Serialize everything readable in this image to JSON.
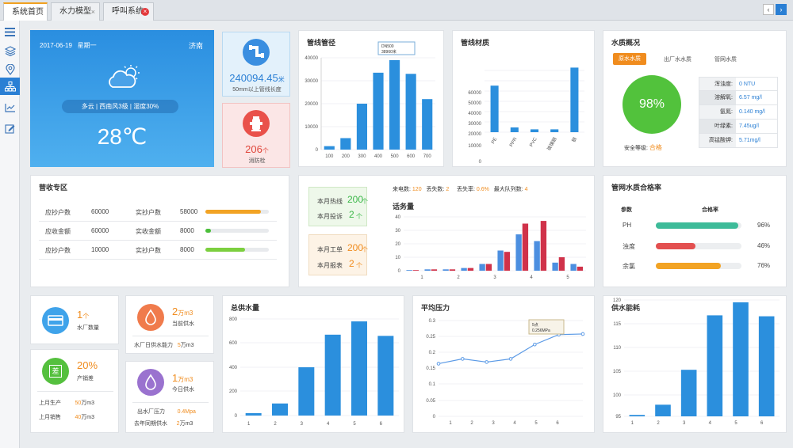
{
  "tabs": [
    {
      "label": "系统首页"
    },
    {
      "label": "水力模型"
    },
    {
      "label": "呼叫系统"
    }
  ],
  "sidebar": [
    "menu-icon",
    "layers-icon",
    "location-icon",
    "org-chart-icon",
    "chart-icon",
    "edit-icon"
  ],
  "weather": {
    "date": "2017-06-19",
    "weekday": "星期一",
    "city": "济南",
    "desc": "多云 | 西南风3级 | 湿度30%",
    "temp": "28℃"
  },
  "pipe_len": {
    "value": "240094.45",
    "unit": "米",
    "label": "50mm以上管线长度"
  },
  "hydrant": {
    "value": "206",
    "unit": "个",
    "label": "消防栓"
  },
  "diameter": {
    "title": "管线管径",
    "tooltip_l1": "DN500",
    "tooltip_l2": "38960米",
    "yticks": [
      "0",
      "10000",
      "20000",
      "30000",
      "40000"
    ]
  },
  "material": {
    "title": "管线材质",
    "yticks": [
      "0",
      "10000",
      "20000",
      "30000",
      "40000",
      "50000",
      "60000"
    ]
  },
  "quality": {
    "title": "水质概况",
    "tabs": [
      "原水水质",
      "出厂水水质",
      "管网水质"
    ],
    "score": "98%",
    "grade_label": "安全等级:",
    "grade": "合格",
    "rows": [
      {
        "k": "浑浊度:",
        "v": "0 NTU"
      },
      {
        "k": "溶解氧:",
        "v": "6.57 mg/l"
      },
      {
        "k": "氨氮:",
        "v": "0.140 mg/l"
      },
      {
        "k": "叶绿素:",
        "v": "7.45ug/l"
      },
      {
        "k": "高锰酸钾:",
        "v": "5.71mg/l"
      }
    ]
  },
  "revenue": {
    "title": "营收专区",
    "rows": [
      {
        "a": "应抄户数",
        "av": "60000",
        "b": "实抄户数",
        "bv": "58000",
        "color": "#f2a324",
        "pct": 0.87
      },
      {
        "a": "应收金额",
        "av": "60000",
        "b": "实收金额",
        "bv": "8000",
        "color": "#4bbf3a",
        "pct": 0.09
      },
      {
        "a": "应抄户数",
        "av": "10000",
        "b": "实抄户数",
        "bv": "8000",
        "color": "#7ccf3f",
        "pct": 0.63
      }
    ]
  },
  "calls": {
    "hotline_label": "本月热线",
    "hotline": "200",
    "hotline_unit": "个",
    "complaint_label": "本月投诉",
    "complaint": "2",
    "complaint_unit": "个",
    "order_label": "本月工单",
    "order": "200",
    "order_unit": "个",
    "report_label": "本月报表",
    "report": "2",
    "report_unit": "个",
    "incoming_label": "来电数:",
    "incoming": "120",
    "lost_label": "丢失数:",
    "lost": "2",
    "rate_label": "丢失率:",
    "rate": "0.6%",
    "queue_label": "最大队列数:",
    "queue": "4",
    "chart_title": "话务量",
    "yticks": [
      "0",
      "10",
      "20",
      "30",
      "40"
    ]
  },
  "pipe_quality": {
    "title": "管网水质合格率",
    "col1": "参数",
    "col2": "合格率",
    "rows": [
      {
        "name": "PH",
        "pct": "96%",
        "color": "#3dbb99"
      },
      {
        "name": "浊度",
        "pct": "46%",
        "color": "#e35050"
      },
      {
        "name": "余氯",
        "pct": "76%",
        "color": "#f2a324"
      }
    ]
  },
  "plants": {
    "count": "1",
    "unit": "个",
    "label": "水厂数量"
  },
  "supply": {
    "value": "2",
    "unit": "万m3",
    "label": "当前供水",
    "cap_label": "水厂日供水能力",
    "cap": "5",
    "cap_unit": "万m3"
  },
  "diff": {
    "value": "20%",
    "label": "产销差",
    "icon_char": "差",
    "prod_label": "上月生产",
    "prod": "50",
    "prod_unit": "万m3",
    "sale_label": "上月销售",
    "sale": "40",
    "sale_unit": "万m3"
  },
  "today": {
    "value": "1",
    "unit": "万m3",
    "label": "今日供水",
    "press_label": "出水厂压力",
    "press": "0.4Mpa",
    "last_label": "去年同期供水",
    "last": "2",
    "last_unit": "万m3"
  },
  "total": {
    "title": "总供水量",
    "yticks": [
      "0",
      "200",
      "400",
      "600",
      "800"
    ]
  },
  "pressure": {
    "title": "平均压力",
    "tooltip_l1": "5点",
    "tooltip_l2": "0.256MPa",
    "yticks": [
      "0",
      "0.05",
      "0.1",
      "0.15",
      "0.2",
      "0.25",
      "0.3"
    ]
  },
  "energy": {
    "title": "供水能耗",
    "yticks": [
      "95",
      "100",
      "105",
      "110",
      "115",
      "120"
    ]
  },
  "chart_data": [
    {
      "type": "bar",
      "title": "管线管径",
      "categories": [
        "100",
        "200",
        "300",
        "400",
        "500",
        "600",
        "700"
      ],
      "values": [
        1500,
        5000,
        20000,
        33500,
        39000,
        33000,
        22000
      ],
      "ylim": [
        0,
        40000
      ]
    },
    {
      "type": "bar",
      "title": "管线材质",
      "categories": [
        "PE",
        "PPR",
        "PVC",
        "玻璃钢",
        "钢"
      ],
      "values": [
        49000,
        5000,
        3000,
        3000,
        68000
      ],
      "ylim": [
        0,
        60000
      ]
    },
    {
      "type": "bar",
      "title": "话务量",
      "x": [
        "1",
        "2",
        "3",
        "4",
        "5"
      ],
      "series": [
        {
          "values": [
            0.5,
            1,
            1,
            2,
            5,
            15,
            27,
            22,
            6,
            5
          ]
        },
        {
          "values": [
            0.5,
            1,
            1,
            2,
            5,
            14,
            35,
            37,
            10,
            3
          ]
        }
      ],
      "ylim": [
        0,
        40
      ]
    },
    {
      "type": "bar",
      "title": "总供水量",
      "categories": [
        "1",
        "2",
        "3",
        "4",
        "5",
        "6"
      ],
      "values": [
        20,
        100,
        400,
        670,
        780,
        660
      ],
      "ylim": [
        0,
        800
      ]
    },
    {
      "type": "line",
      "title": "平均压力",
      "categories": [
        "1",
        "2",
        "3",
        "4",
        "5",
        "6"
      ],
      "values": [
        0.165,
        0.18,
        0.17,
        0.18,
        0.225,
        0.256,
        0.258
      ],
      "ylim": [
        0,
        0.3
      ]
    },
    {
      "type": "bar",
      "title": "供水能耗",
      "categories": [
        "1",
        "2",
        "3",
        "4",
        "5",
        "6"
      ],
      "values": [
        95.3,
        97.5,
        105,
        116.7,
        119.5,
        116.5
      ],
      "ylim": [
        95,
        120
      ]
    }
  ]
}
